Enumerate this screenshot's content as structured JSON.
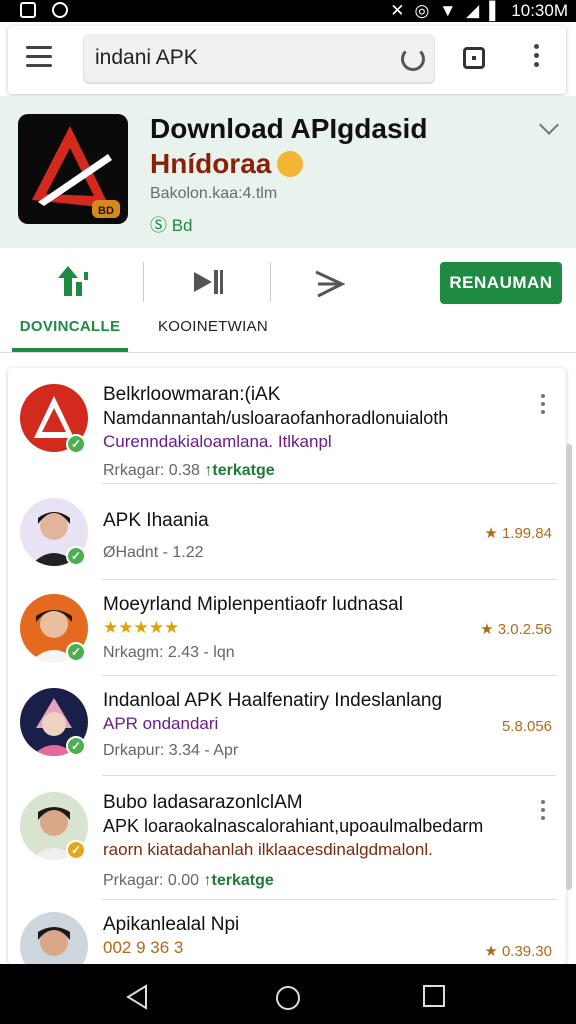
{
  "status": {
    "time": "10:30M",
    "icons": [
      "gallery-icon",
      "record-icon",
      "mute-icon",
      "alarm-icon",
      "wifi-icon",
      "signal-icon",
      "battery-icon"
    ]
  },
  "search": {
    "query": "indani APK",
    "icons": [
      "menu-icon",
      "reload-icon",
      "tab-icon",
      "more-icon"
    ]
  },
  "app": {
    "title": "Download APIgdasid",
    "subtitle": "Hnídoraa",
    "meta": "Bakolon.kaa:4.tlm",
    "badge": "Ⓢ Bd",
    "logo_badge": "BD"
  },
  "toolbar": {
    "action_label": "RENAUMAN",
    "tab_download": "DOVINCALLE",
    "tab_other": "KOOINETWIAN"
  },
  "colors": {
    "accent": "#1f8a42",
    "header_bg": "#e9f3ee",
    "title_red": "#8a1f0a",
    "rating_orange": "#b06a1a"
  },
  "items": [
    {
      "title": "Belkrloowmaran:(iAK",
      "desc": "Namdannantah/usloaraofanhoradlonuialoth",
      "desc2": "Curenndakialoamlana. Itlkanpl",
      "meta": "Rrkagar: 0.38",
      "tag": "↑terkatge"
    },
    {
      "title": "APK Ihaania",
      "meta": "ØHadnt - 1.22",
      "rating": "★ 1.99.84"
    },
    {
      "title": "Moeyrland Miplenpentiaofr ludnasal",
      "stars": "★★★★★",
      "meta": "Nrkagm: 2.43 - lqn",
      "rating": "★ 3.0.2.56"
    },
    {
      "title": "Indanloal APK Haalfenatiry Indeslanlang",
      "desc": "APR ondandari",
      "meta": "Drkapur: 3.34 - Apr",
      "rating": "5.8.056"
    },
    {
      "title": "Bubo ladasarazonlclAM",
      "desc": "APK loaraokalnascalorahiant,upoaulmalbedarm",
      "desc2": "raorn kiatadahanlah ilklaacesdinalgdmalonl.",
      "meta": "Prkagar: 0.00",
      "tag": "↑terkatge"
    },
    {
      "title": "Apikanlealal Npi",
      "digits": "002 9 36 3",
      "rating": "★ 0.39.30"
    }
  ]
}
